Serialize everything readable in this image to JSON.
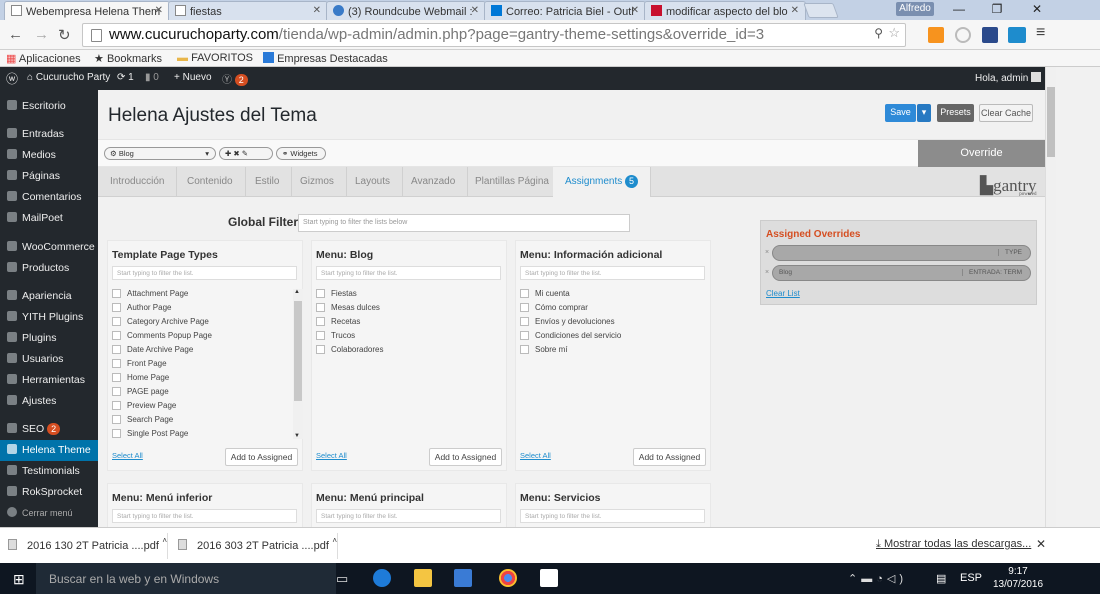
{
  "browser": {
    "tabs": [
      {
        "title": "Webempresa Helena Them"
      },
      {
        "title": "fiestas"
      },
      {
        "title": "(3) Roundcube Webmail :"
      },
      {
        "title": "Correo: Patricia Biel - Outl"
      },
      {
        "title": "modificar aspecto del blo"
      }
    ],
    "profile": "Alfredo",
    "url_host": "www.cucuruchoparty.com",
    "url_path": "/tienda/wp-admin/admin.php?page=gantry-theme-settings&override_id=3",
    "bookmarks": [
      "Aplicaciones",
      "Bookmarks",
      "FAVORITOS",
      "Empresas Destacadas"
    ]
  },
  "adminbar": {
    "site": "Cucurucho Party",
    "updates": "1",
    "comments": "0",
    "new": "Nuevo",
    "yoast_badge": "2",
    "greeting": "Hola, admin"
  },
  "sidebar": {
    "items": [
      {
        "label": "Escritorio"
      },
      {
        "label": "Entradas"
      },
      {
        "label": "Medios"
      },
      {
        "label": "Páginas"
      },
      {
        "label": "Comentarios"
      },
      {
        "label": "MailPoet"
      },
      {
        "label": "WooCommerce"
      },
      {
        "label": "Productos"
      },
      {
        "label": "Apariencia"
      },
      {
        "label": "YITH Plugins"
      },
      {
        "label": "Plugins"
      },
      {
        "label": "Usuarios"
      },
      {
        "label": "Herramientas"
      },
      {
        "label": "Ajustes"
      },
      {
        "label": "SEO",
        "badge": "2"
      },
      {
        "label": "Helena Theme"
      },
      {
        "label": "Testimonials"
      },
      {
        "label": "RokSprocket"
      },
      {
        "label": "Cerrar menú"
      }
    ]
  },
  "page": {
    "title": "Helena Ajustes del Tema",
    "save": "Save",
    "presets": "Presets",
    "clear_cache": "Clear Cache",
    "override_select": "Blog",
    "widgets": "Widgets",
    "override": "Override",
    "logo": "gantry",
    "logo_sub": "powered"
  },
  "tabs": [
    {
      "label": "Introducción"
    },
    {
      "label": "Contenido"
    },
    {
      "label": "Estilo"
    },
    {
      "label": "Gizmos"
    },
    {
      "label": "Layouts"
    },
    {
      "label": "Avanzado"
    },
    {
      "label": "Plantillas Página"
    },
    {
      "label": "Assignments",
      "count": "5"
    }
  ],
  "global_filter": {
    "label": "Global Filter",
    "placeholder": "Start typing to filter the lists below"
  },
  "panels": [
    {
      "title": "Template Page Types",
      "filter": "Start typing to filter the list.",
      "items": [
        "Attachment Page",
        "Author Page",
        "Category Archive Page",
        "Comments Popup Page",
        "Date Archive Page",
        "Front Page",
        "Home Page",
        "PAGE page",
        "Preview Page",
        "Search Page",
        "Single Post Page"
      ]
    },
    {
      "title": "Menu: Blog",
      "filter": "Start typing to filter the list.",
      "items": [
        "Fiestas",
        "Mesas dulces",
        "Recetas",
        "Trucos",
        "Colaboradores"
      ]
    },
    {
      "title": "Menu: Información adicional",
      "filter": "Start typing to filter the list.",
      "items": [
        "Mi cuenta",
        "Cómo comprar",
        "Envíos y devoluciones",
        "Condiciones del servicio",
        "Sobre mí"
      ]
    },
    {
      "title": "Menu: Menú inferior",
      "filter": "Start typing to filter the list."
    },
    {
      "title": "Menu: Menú principal",
      "filter": "Start typing to filter the list."
    },
    {
      "title": "Menu: Servicios",
      "filter": "Start typing to filter the list."
    }
  ],
  "panel_actions": {
    "select_all": "Select All",
    "add": "Add to Assigned"
  },
  "assigned": {
    "title": "Assigned Overrides",
    "rows": [
      {
        "name": "",
        "tag": "TYPE"
      },
      {
        "name": "Blog",
        "tag": "ENTRADA: TERM"
      }
    ],
    "clear": "Clear List"
  },
  "downloads": {
    "files": [
      "2016 130 2T Patricia ....pdf",
      "2016 303 2T Patricia ....pdf"
    ],
    "show_all": "Mostrar todas las descargas..."
  },
  "taskbar": {
    "search": "Buscar en la web y en Windows",
    "lang": "ESP",
    "time": "9:17",
    "date": "13/07/2016"
  }
}
